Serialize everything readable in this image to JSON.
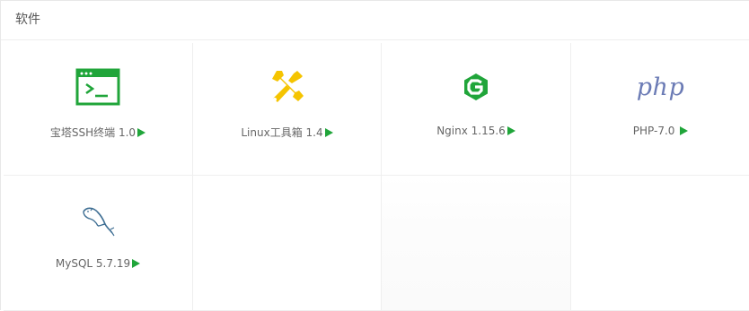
{
  "panel": {
    "title": "软件"
  },
  "software": [
    {
      "name": "宝塔SSH终端 1.0",
      "icon": "terminal-icon",
      "color": "#20a53a"
    },
    {
      "name": "Linux工具箱 1.4",
      "icon": "tools-icon",
      "color": "#f5c400"
    },
    {
      "name": "Nginx 1.15.6",
      "icon": "nginx-icon",
      "color": "#20a53a"
    },
    {
      "name": "PHP-7.0",
      "icon": "php-icon",
      "icon_text": "php",
      "color": "#6b7bb5"
    },
    {
      "name": "MySQL 5.7.19",
      "icon": "mysql-dolphin-icon",
      "color": "#3e6e93"
    }
  ],
  "colors": {
    "accent": "#20a53a",
    "border": "#efefef",
    "text": "#666666"
  }
}
